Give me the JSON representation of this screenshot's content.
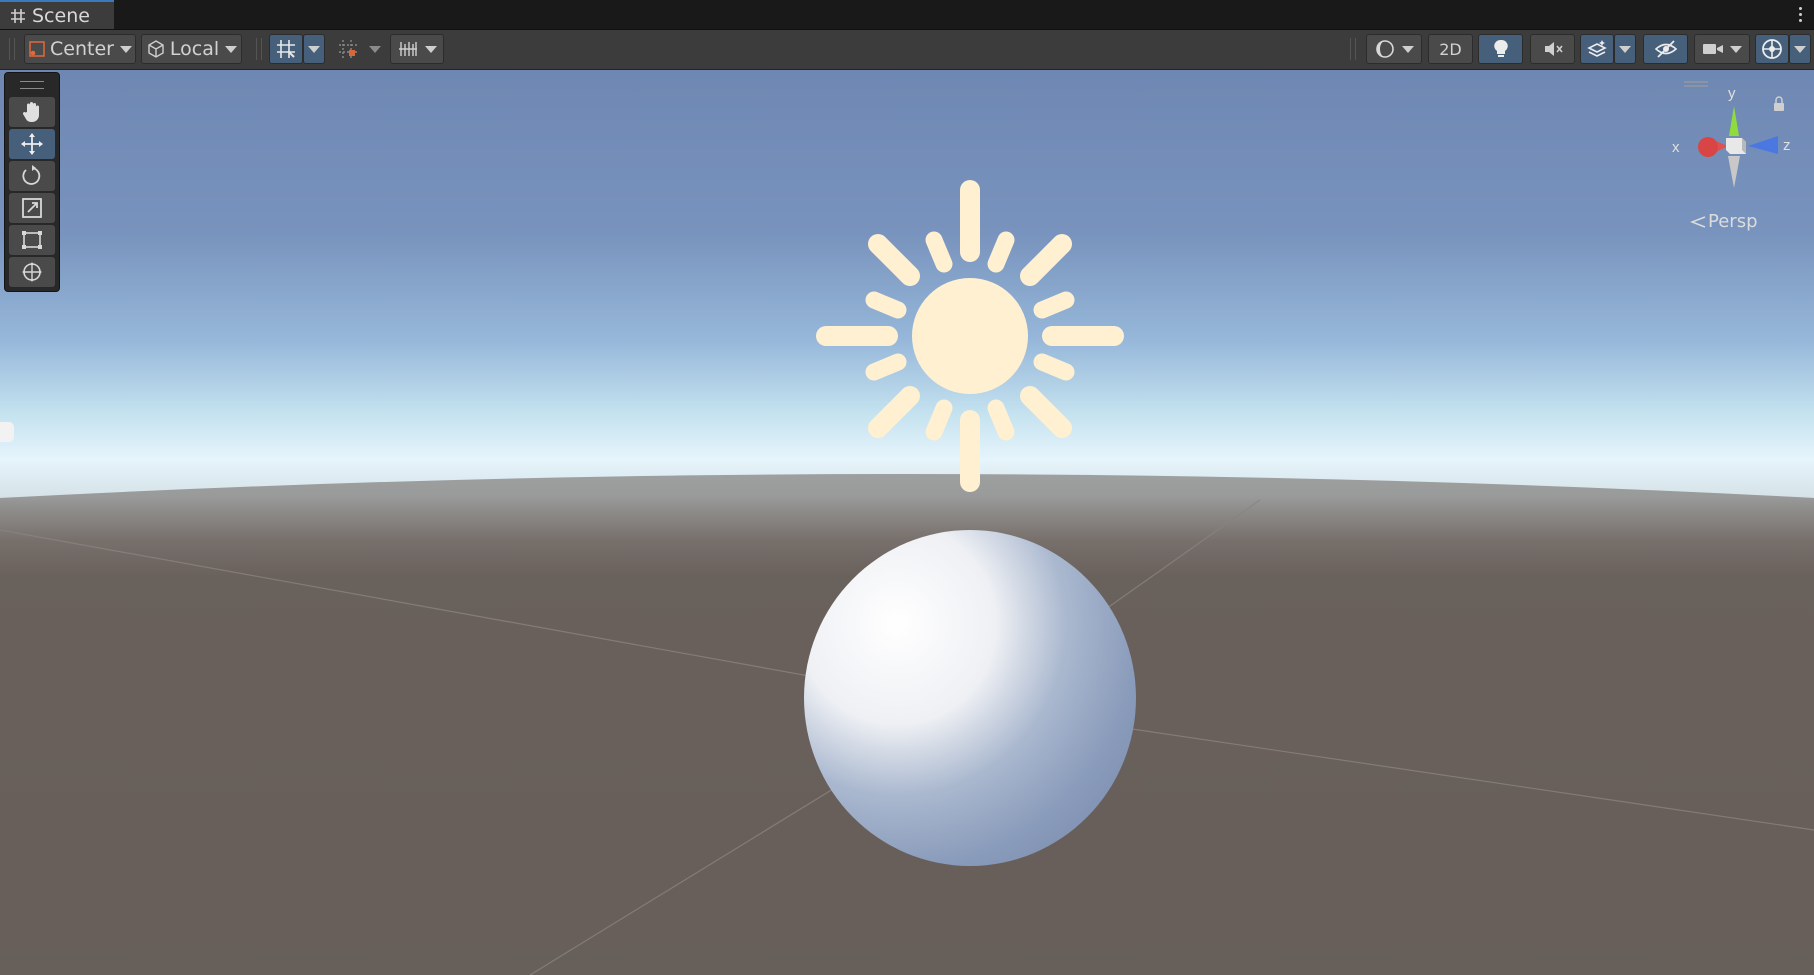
{
  "window": {
    "tab_title": "Scene"
  },
  "toolbar": {
    "pivot_label": "Center",
    "space_label": "Local",
    "mode_2d_label": "2D",
    "draw_mode_icon": "shading-mode-icon",
    "lighting_icon": "light-bulb-icon",
    "audio_icon": "audio-mute-icon",
    "effects_icon": "effects-icon",
    "visibility_icon": "hidden-objects-icon",
    "camera_icon": "camera-icon",
    "gizmos_icon": "gizmos-icon"
  },
  "tools": [
    {
      "name": "hand-tool",
      "icon": "hand-icon"
    },
    {
      "name": "move-tool",
      "icon": "move-arrows-icon",
      "active": true
    },
    {
      "name": "rotate-tool",
      "icon": "rotate-icon"
    },
    {
      "name": "scale-tool",
      "icon": "scale-icon"
    },
    {
      "name": "rect-tool",
      "icon": "rect-transform-icon"
    },
    {
      "name": "transform-tool",
      "icon": "transform-icon"
    }
  ],
  "gizmo": {
    "x_label": "x",
    "y_label": "y",
    "z_label": "z",
    "projection_label": "Persp"
  },
  "colors": {
    "sky_top": "#6e88b3",
    "sky_horizon": "#e6f4fb",
    "ground": "#675f5a",
    "sun": "#fff0d2",
    "accent": "#46607c",
    "axis_x": "#e05050",
    "axis_y": "#8fdc3c",
    "axis_z": "#4a78e0"
  }
}
